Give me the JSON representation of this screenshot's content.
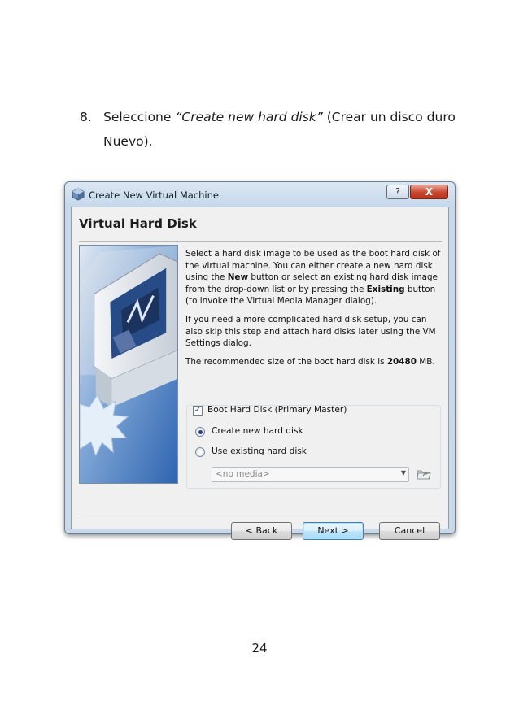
{
  "document": {
    "step_number": "8.",
    "step_text_before": "Seleccione ",
    "step_text_emphasis": "“Create new hard disk”",
    "step_text_after": " (Crear un disco duro Nuevo).",
    "page_number": "24"
  },
  "window": {
    "title": "Create New Virtual Machine",
    "help_button": "?",
    "close_button": "X",
    "heading": "Virtual Hard Disk",
    "description": {
      "p1_a": "Select a hard disk image to be used as the boot hard disk of the virtual machine. You can either create a new hard disk using the ",
      "p1_new": "New",
      "p1_b": " button or select an existing hard disk image from the drop-down list or by pressing the ",
      "p1_existing": "Existing",
      "p1_c": " button (to invoke the Virtual Media Manager dialog).",
      "p2": "If you need a more complicated hard disk setup, you can also skip this step and attach hard disks later using the VM Settings dialog.",
      "p3_a": "The recommended size of the boot hard disk is ",
      "p3_size": "20480",
      "p3_b": " MB."
    },
    "boot_disk": {
      "label": "Boot Hard Disk (Primary Master)",
      "checked": true
    },
    "options": [
      {
        "label": "Create new hard disk",
        "selected": true
      },
      {
        "label": "Use existing hard disk",
        "selected": false
      }
    ],
    "media_select": {
      "value": "<no media>"
    },
    "buttons": {
      "back": "< Back",
      "next": "Next >",
      "cancel": "Cancel"
    }
  },
  "icons": {
    "app": "virtualbox-icon",
    "folder": "open-media-folder-icon",
    "art": "sun-monitor-wizard-art"
  },
  "colors": {
    "title_gradient_top": "#dbe7f3",
    "close_red": "#c7462f",
    "art_blue": "#3b6fb8"
  }
}
